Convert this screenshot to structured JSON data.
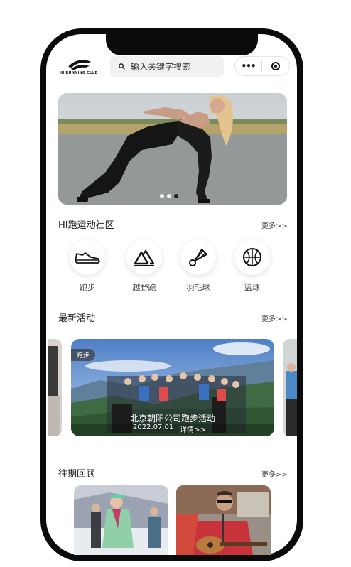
{
  "header": {
    "logo_text": "HI RUNNING CLUB",
    "search_placeholder": "输入关键字搜索",
    "capsule_more": "•••"
  },
  "banner": {
    "slide_count": 3,
    "active_slide": 3
  },
  "community": {
    "title": "HI跑运动社区",
    "more": "更多>>",
    "categories": [
      {
        "label": "跑步",
        "icon": "running-shoe-icon"
      },
      {
        "label": "越野跑",
        "icon": "mountain-icon"
      },
      {
        "label": "羽毛球",
        "icon": "shuttlecock-icon"
      },
      {
        "label": "篮球",
        "icon": "basketball-icon"
      }
    ]
  },
  "activities": {
    "title": "最新活动",
    "more": "更多>>",
    "card": {
      "tag": "跑步",
      "title": "北京朝阳公司跑步活动",
      "date": "2022.07.01",
      "detail": "详情>>"
    }
  },
  "review": {
    "title": "往期回顾",
    "more": "更多>>"
  }
}
